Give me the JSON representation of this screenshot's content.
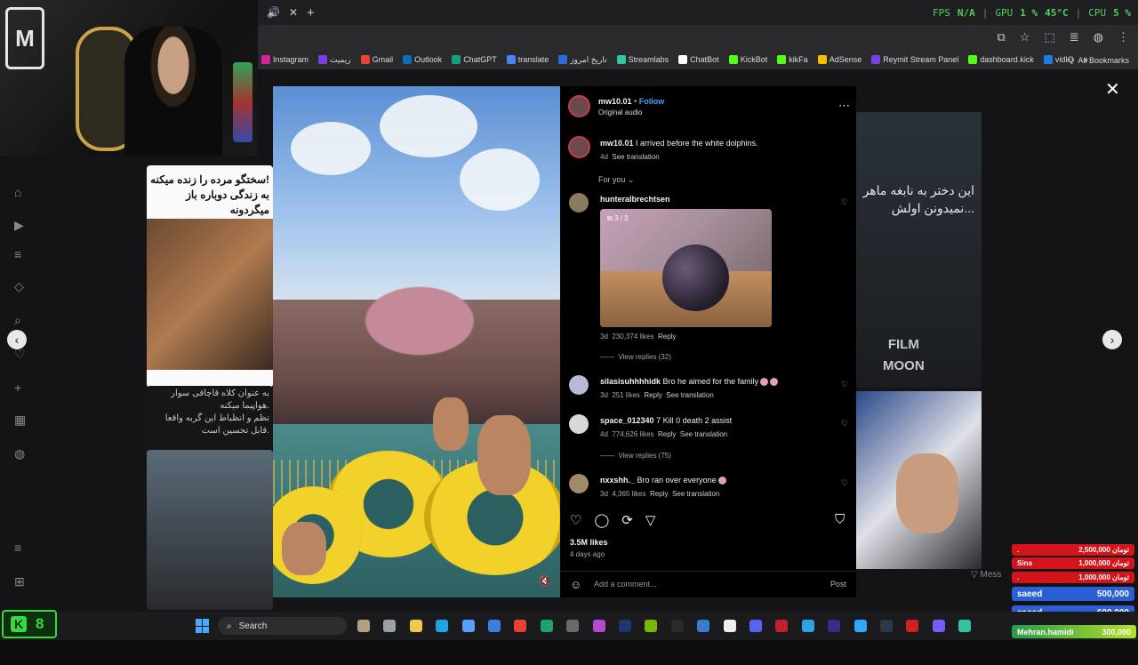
{
  "browser": {
    "tab_audio_icon": "speaker-icon",
    "tab_close": "✕",
    "new_tab": "+",
    "perf": {
      "fps_label": "FPS",
      "fps_value": "N/A",
      "gpu_label": "GPU",
      "gpu_value": "1 %",
      "gpu_temp": "45°C",
      "cpu_label": "CPU",
      "cpu_value": "5 %"
    },
    "bookmarks": [
      {
        "label": "Instagram",
        "color": "#d6249f"
      },
      {
        "label": "ریمیت",
        "color": "#7b3fe4"
      },
      {
        "label": "Gmail",
        "color": "#ea4335"
      },
      {
        "label": "Outlook",
        "color": "#0f6cbd"
      },
      {
        "label": "ChatGPT",
        "color": "#10a37f"
      },
      {
        "label": "translate",
        "color": "#4285f4"
      },
      {
        "label": "تاریخ امروز",
        "color": "#2f6bd6"
      },
      {
        "label": "Streamlabs",
        "color": "#31c3a2"
      },
      {
        "label": "ChatBot",
        "color": "#ffffff"
      },
      {
        "label": "KickBot",
        "color": "#53fc18"
      },
      {
        "label": "kikFa",
        "color": "#53fc18"
      },
      {
        "label": "AdSense",
        "color": "#fbbc04"
      },
      {
        "label": "Reymit Stream Panel",
        "color": "#7b3fe4"
      },
      {
        "label": "dashboard.kick",
        "color": "#53fc18"
      },
      {
        "label": "vidIQ",
        "color": "#1c7ce0"
      }
    ],
    "all_bookmarks": "All Bookmarks"
  },
  "background": {
    "left_card_1_text": [
      "سختگو مرده را زنده میکنه!",
      "به زندگی دوباره باز میگردونه"
    ],
    "left_card_2_text": [
      "به عنوان کلاه قاچاقی سوار",
      "هواپیما میکنه.",
      "نظم و انظباط این گربه واقعا",
      "قابل تحسین است."
    ],
    "right_card_1_text": [
      "این دختر به نابغه ماهر",
      "نمیدونن اولش..."
    ],
    "right_card_watermark": [
      "FILM",
      "MOON"
    ],
    "message_hint": "Mess"
  },
  "post": {
    "username": "mw10.01",
    "dot": "•",
    "follow": "Follow",
    "audio": "Original audio",
    "caption_user": "mw10.01",
    "caption_text": "I arrived before the white dolphins.",
    "caption_age": "4d",
    "see_translation": "See translation",
    "for_you": "For you",
    "likes": "3.5M likes",
    "posted": "4 days ago",
    "comment_placeholder": "Add a comment...",
    "post_button": "Post"
  },
  "comments": [
    {
      "user": "hunteralbrechtsen",
      "text": "",
      "age": "3d",
      "likes": "230,374 likes",
      "reply": "Reply",
      "image_badge": "3 / 3",
      "view_replies": "View replies (32)"
    },
    {
      "user": "silasisuhhhhidk",
      "text": "Bro he aimed for the family",
      "age": "3d",
      "likes": "251 likes",
      "reply": "Reply",
      "translate": "See translation"
    },
    {
      "user": "space_012340",
      "text": "7 Kill 0 death 2 assist",
      "age": "4d",
      "likes": "774,626 likes",
      "reply": "Reply",
      "translate": "See translation",
      "view_replies": "View replies (75)"
    },
    {
      "user": "nxxshh._",
      "text": "Bro ran over everyone",
      "age": "3d",
      "likes": "4,365 likes",
      "reply": "Reply",
      "translate": "See translation"
    }
  ],
  "donations": [
    {
      "name": ".",
      "amount": "2,500,000 تومان",
      "color": "#d3141a"
    },
    {
      "name": "Sina",
      "amount": "1,000,000 تومان",
      "color": "#d3141a"
    },
    {
      "name": ".",
      "amount": "1,000,000 تومان",
      "color": "#d3141a"
    },
    {
      "name": "saeed",
      "amount": "500,000",
      "color": "#2a5fd6"
    },
    {
      "name": "saeed",
      "amount": "600,000",
      "color": "#2a5fd6"
    }
  ],
  "last_donation": {
    "name": "Mehran.hamidi",
    "amount": "300,000"
  },
  "taskbar": {
    "kick_letter": "K",
    "kick_count": "8",
    "search": "Search"
  },
  "accent": {
    "kick_green": "#39d93a",
    "follow_blue": "#4a9fff"
  }
}
